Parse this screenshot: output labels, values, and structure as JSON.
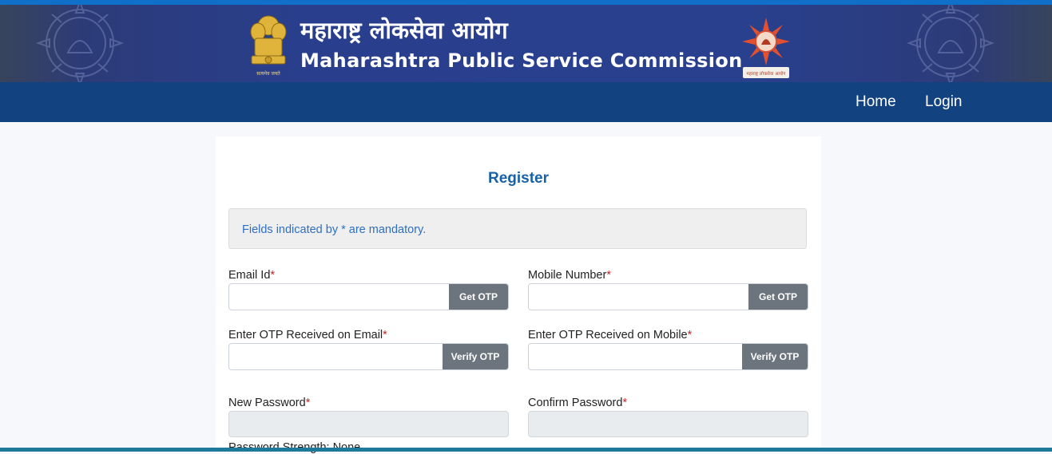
{
  "header": {
    "title_marathi": "महाराष्ट्र लोकसेवा आयोग",
    "title_english": "Maharashtra Public Service Commission",
    "emblem_caption": "सत्यमेव जयते",
    "logo_caption": "महाराष्ट्र लोकसेवा आयोग"
  },
  "nav": {
    "home": "Home",
    "login": "Login"
  },
  "form": {
    "title": "Register",
    "notice": "Fields indicated by * are mandatory.",
    "required_marker": "*",
    "email_label": "Email Id",
    "mobile_label": "Mobile Number",
    "email_otp_label": "Enter OTP Received on Email",
    "mobile_otp_label": "Enter OTP Received on Mobile",
    "new_password_label": "New Password",
    "confirm_password_label": "Confirm Password",
    "get_otp": "Get OTP",
    "verify_otp": "Verify OTP",
    "password_strength": "Password Strength: None"
  },
  "colors": {
    "nav_bg": "#12427f",
    "title_blue": "#1861a9",
    "button_gray": "#6c757d",
    "required_red": "#c0282d"
  }
}
